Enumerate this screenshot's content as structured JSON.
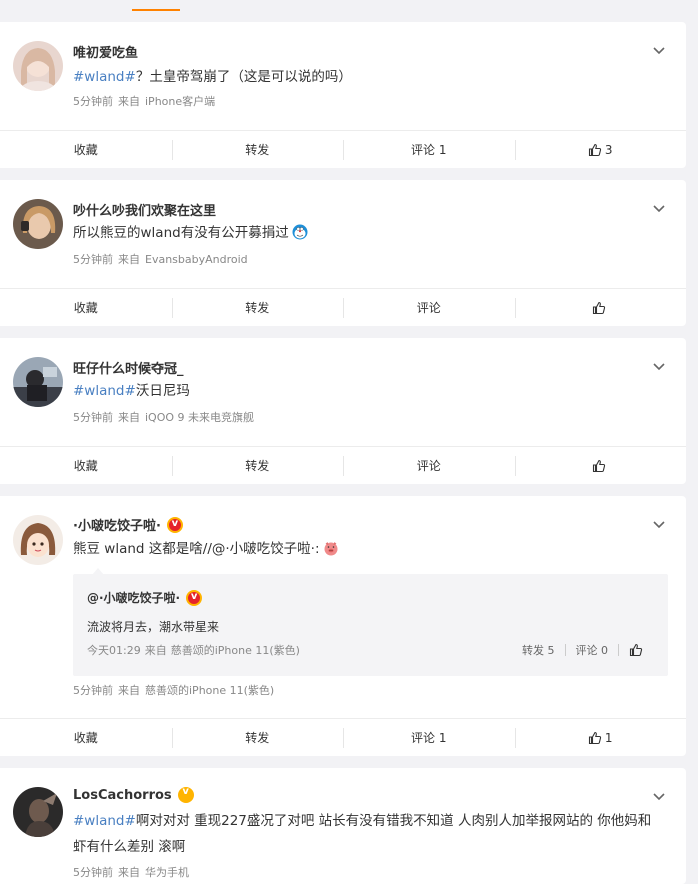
{
  "posts": [
    {
      "username": "唯初爱吃鱼",
      "tag": "#wland#",
      "text": "？土皇帝驾崩了（这是可以说的吗）",
      "time": "5分钟前",
      "source_prefix": "来自",
      "source": "iPhone客户端",
      "actions": {
        "collect": "收藏",
        "forward": "转发",
        "comment": "评论 1",
        "like": "3"
      }
    },
    {
      "username": "吵什么吵我们欢聚在这里",
      "text": "所以熊豆的wland有没有公开募捐过",
      "emoji": "doraemon-emoji",
      "time": "5分钟前",
      "source_prefix": "来自",
      "source": "EvansbabyAndroid",
      "actions": {
        "collect": "收藏",
        "forward": "转发",
        "comment": "评论",
        "like": ""
      }
    },
    {
      "username": "旺仔什么时候夺冠_",
      "tag": "#wland#",
      "text": "沃日尼玛",
      "time": "5分钟前",
      "source_prefix": "来自",
      "source": "iQOO 9 未来电竞旗舰",
      "actions": {
        "collect": "收藏",
        "forward": "转发",
        "comment": "评论",
        "like": ""
      }
    },
    {
      "username": "·小啵吃饺子啦·",
      "text": "熊豆 wland 这都是啥//@·小啵吃饺子啦·:",
      "emoji": "pig-emoji",
      "repost": {
        "username": "@·小啵吃饺子啦·",
        "text": "流波将月去，潮水带星来",
        "time": "今天01:29",
        "source_prefix": "来自",
        "source": "慈善颂的iPhone 11(紫色)",
        "forward": "转发 5",
        "comment": "评论 0"
      },
      "time": "5分钟前",
      "source_prefix": "来自",
      "source": "慈善颂的iPhone 11(紫色)",
      "actions": {
        "collect": "收藏",
        "forward": "转发",
        "comment": "评论 1",
        "like": "1"
      }
    },
    {
      "username": "LosCachorros",
      "tag": "#wland#",
      "text": "啊对对对 重现227盛况了对吧 站长有没有错我不知道 人肉别人加举报网站的 你他妈和虾有什么差别 滚啊",
      "time": "5分钟前",
      "source_prefix": "来自",
      "source": "华为手机"
    }
  ],
  "colors": {
    "accent": "#ff8200",
    "link": "#4a80c2",
    "vip_red": "#e5232a",
    "vip_gold": "#ffb400"
  }
}
